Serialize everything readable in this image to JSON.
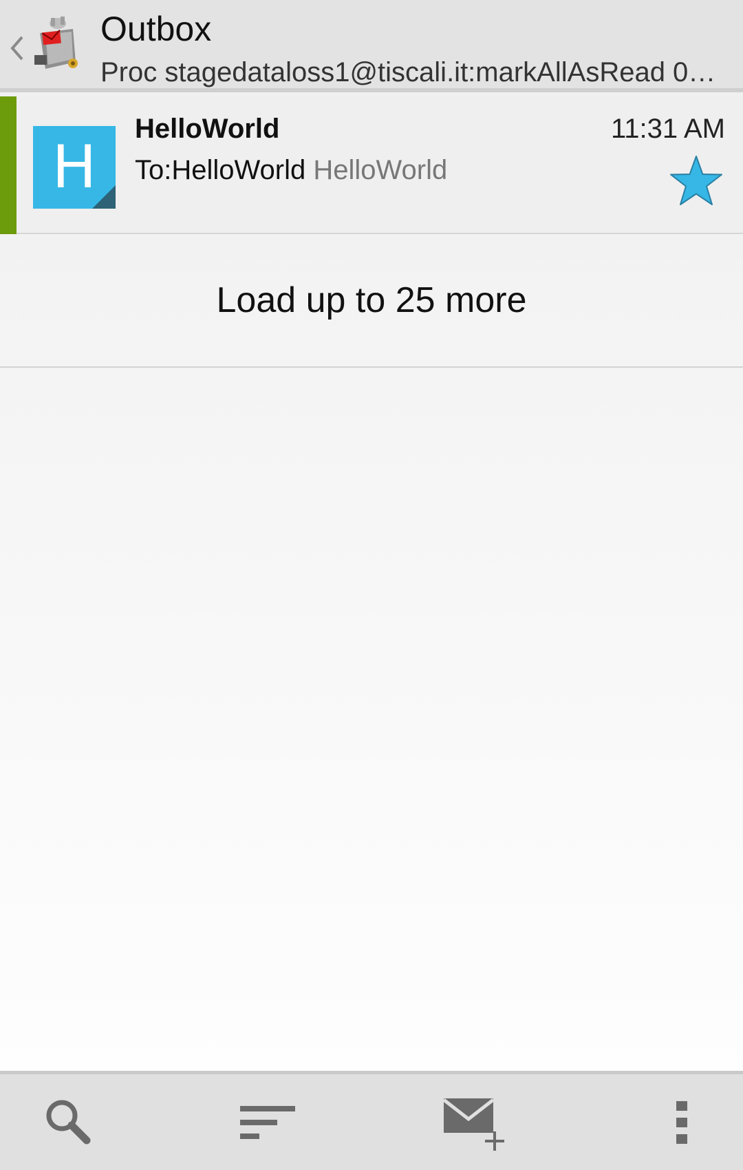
{
  "header": {
    "title": "Outbox",
    "subtitle": "Proc stagedataloss1@tiscali.it:markAllAsRead 0…",
    "back_icon": "chevron-left-icon",
    "logo_icon": "app-logo"
  },
  "messages": [
    {
      "sender": "HelloWorld",
      "time": "11:31 AM",
      "recipient": "To:HelloWorld",
      "preview": "HelloWorld",
      "avatar_letter": "H",
      "avatar_color": "#36b7e6",
      "unread_bar_color": "#6c9b0c",
      "starred": true,
      "star_color": "#36b7e6"
    }
  ],
  "load_more": {
    "label": "Load up to 25 more"
  },
  "toolbar": {
    "search_icon": "search-icon",
    "sort_icon": "sort-icon",
    "compose_icon": "compose-icon",
    "overflow_icon": "overflow-menu-icon"
  }
}
